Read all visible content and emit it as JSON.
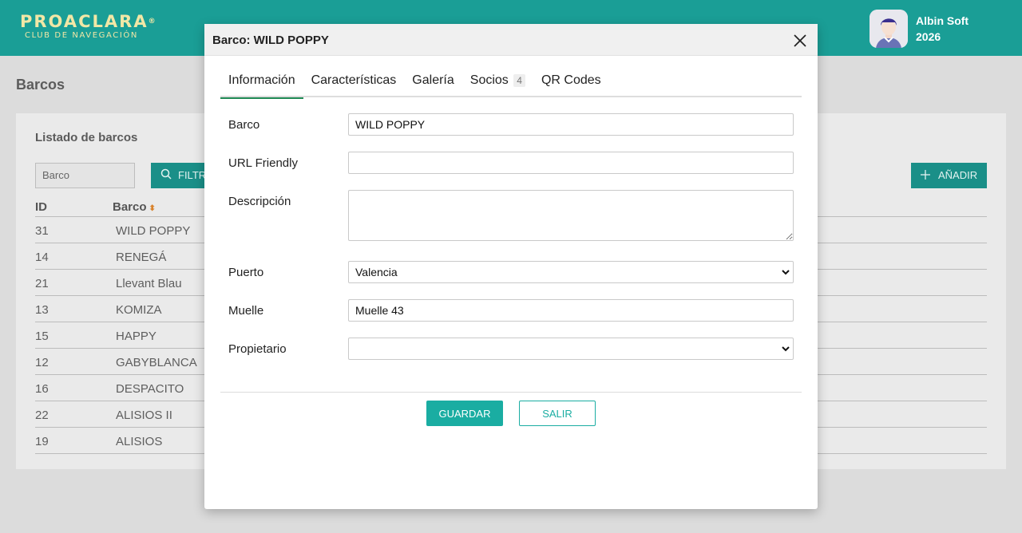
{
  "header": {
    "logo_main": "PROACLARA",
    "logo_reg": "®",
    "logo_sub": "CLUB DE NAVEGACIÓN",
    "user_name_line1": "Albin Soft",
    "user_name_line2": "2026",
    "icons": {
      "avatar": "user-avatar-icon"
    }
  },
  "page": {
    "title": "Barcos",
    "card_title": "Listado de barcos",
    "filter_placeholder": "Barco",
    "filter_button": "FILTR",
    "add_button": "AÑADIR",
    "table": {
      "headers": [
        "ID",
        "Barco"
      ],
      "rows": [
        {
          "id": "31",
          "name": "WILD POPPY"
        },
        {
          "id": "14",
          "name": "RENEGÁ"
        },
        {
          "id": "21",
          "name": "Llevant Blau"
        },
        {
          "id": "13",
          "name": "KOMIZA"
        },
        {
          "id": "15",
          "name": "HAPPY"
        },
        {
          "id": "12",
          "name": "GABYBLANCA"
        },
        {
          "id": "16",
          "name": "DESPACITO"
        },
        {
          "id": "22",
          "name": "ALISIOS II"
        },
        {
          "id": "19",
          "name": "ALISIOS"
        }
      ]
    }
  },
  "modal": {
    "title": "Barco: WILD POPPY",
    "tabs": [
      {
        "label": "Información",
        "active": true
      },
      {
        "label": "Características",
        "active": false
      },
      {
        "label": "Galería",
        "active": false
      },
      {
        "label": "Socios",
        "badge": "4",
        "active": false
      },
      {
        "label": "QR Codes",
        "active": false
      }
    ],
    "fields": {
      "barco": {
        "label": "Barco",
        "value": "WILD POPPY"
      },
      "url_friendly": {
        "label": "URL Friendly",
        "value": ""
      },
      "descripcion": {
        "label": "Descripción",
        "value": ""
      },
      "puerto": {
        "label": "Puerto",
        "value": "Valencia"
      },
      "muelle": {
        "label": "Muelle",
        "value": "Muelle 43"
      },
      "propietario": {
        "label": "Propietario",
        "value": ""
      }
    },
    "save_label": "GUARDAR",
    "exit_label": "SALIR"
  },
  "colors": {
    "header_bg": "#1a9e96",
    "logo": "#f1e7a6",
    "accent": "#1aada2",
    "active_tab": "#1f8a55"
  }
}
